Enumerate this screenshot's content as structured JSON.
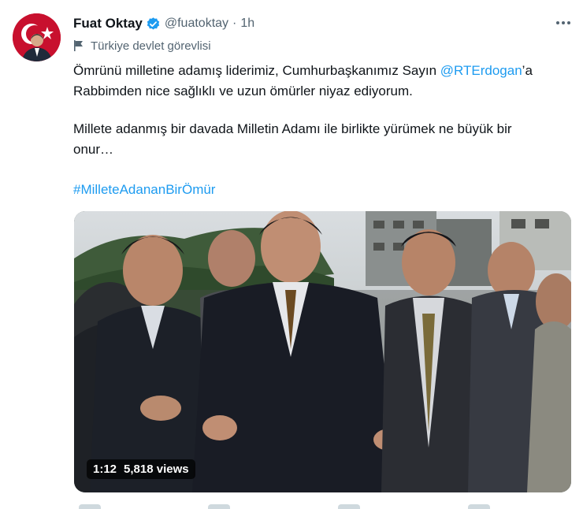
{
  "tweet": {
    "author": {
      "name": "Fuat Oktay",
      "handle": "@fuatoktay",
      "separator": "·",
      "time": "1h",
      "verified_icon": "verified-badge-icon",
      "label_icon": "flag-icon",
      "label": "Türkiye devlet görevlisi"
    },
    "more_icon": "more-options-icon",
    "body": {
      "line1_before": "Ömrünü milletine adamış liderimiz, Cumhurbaşkanımız Sayın ",
      "mention": "@RTErdogan",
      "line1_after": "’a",
      "line2": "Rabbimden nice sağlıklı ve uzun ömürler niyaz ediyorum.",
      "para2_line1": "Millete adanmış bir davada Milletin Adamı ile birlikte yürümek ne büyük bir",
      "para2_line2": "onur…",
      "hashtag": "#MilleteAdananBirÖmür"
    },
    "media": {
      "type": "video",
      "duration": "1:12",
      "views": "5,818 views"
    }
  },
  "colors": {
    "link": "#1d9bf0",
    "verified": "#1d9bf0",
    "secondary_text": "#536471",
    "primary_text": "#0f1419"
  }
}
